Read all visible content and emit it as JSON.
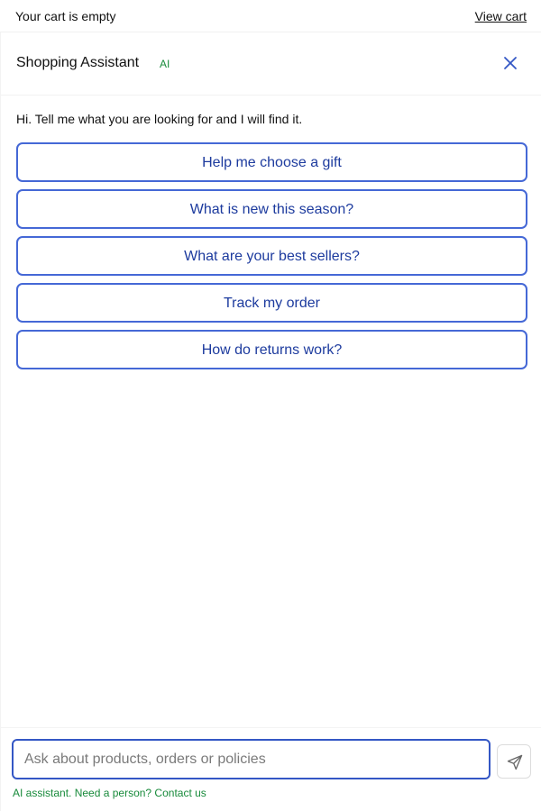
{
  "cart": {
    "status": "Your cart is empty",
    "view_link": "View cart"
  },
  "assistant": {
    "title": "Shopping Assistant",
    "badge": "AI",
    "close_icon": "close-icon",
    "greeting": "Hi. Tell me what you are looking for and I will find it."
  },
  "suggestions": [
    {
      "label": "Help me choose a gift"
    },
    {
      "label": "What is new this season?"
    },
    {
      "label": "What are your best sellers?"
    },
    {
      "label": "Track my order"
    },
    {
      "label": "How do returns work?"
    }
  ],
  "composer": {
    "value": "",
    "placeholder": "Ask about products, orders or policies",
    "send_icon": "send-icon",
    "footer_note": "AI assistant. Need a person? Contact us"
  },
  "colors": {
    "accent": "#4568d6",
    "accent_text": "#1d3b9e",
    "ai_green": "#178a3a"
  }
}
